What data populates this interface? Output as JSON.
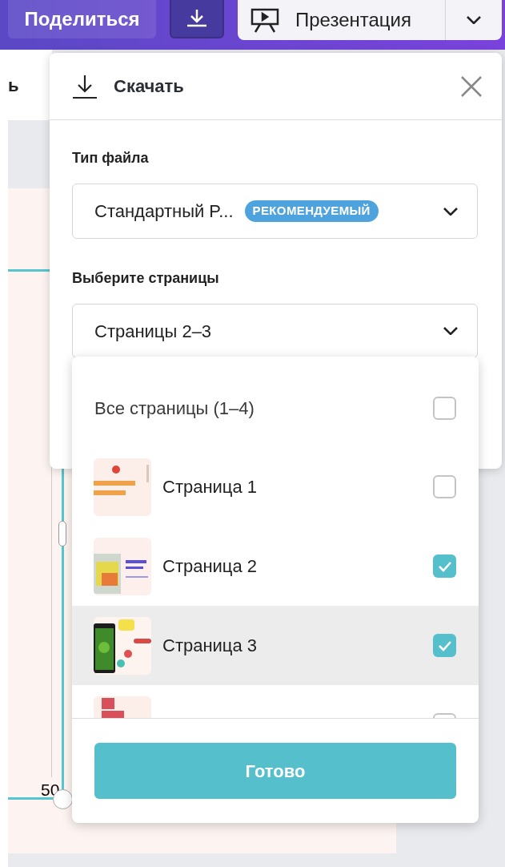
{
  "top_bar": {
    "share_button": "Поделиться",
    "present_button": "Презентация"
  },
  "canvas": {
    "cut_label": "ь",
    "ruler_value": "50"
  },
  "download_panel": {
    "title": "Скачать",
    "file_type": {
      "label": "Тип файла",
      "value": "Стандартный P...",
      "badge": "РЕКОМЕНДУЕМЫЙ"
    },
    "pages": {
      "label": "Выберите страницы",
      "value": "Страницы 2–3"
    }
  },
  "page_list": {
    "all": {
      "label": "Все страницы (1–4)",
      "checked": false
    },
    "items": [
      {
        "label": "Страница 1",
        "checked": false,
        "selected": false,
        "kind": "title"
      },
      {
        "label": "Страница 2",
        "checked": true,
        "selected": false,
        "kind": "cube"
      },
      {
        "label": "Страница 3",
        "checked": true,
        "selected": true,
        "kind": "phone"
      },
      {
        "checked": false,
        "selected": false,
        "kind": "bars"
      }
    ],
    "done_button": "Готово"
  }
}
